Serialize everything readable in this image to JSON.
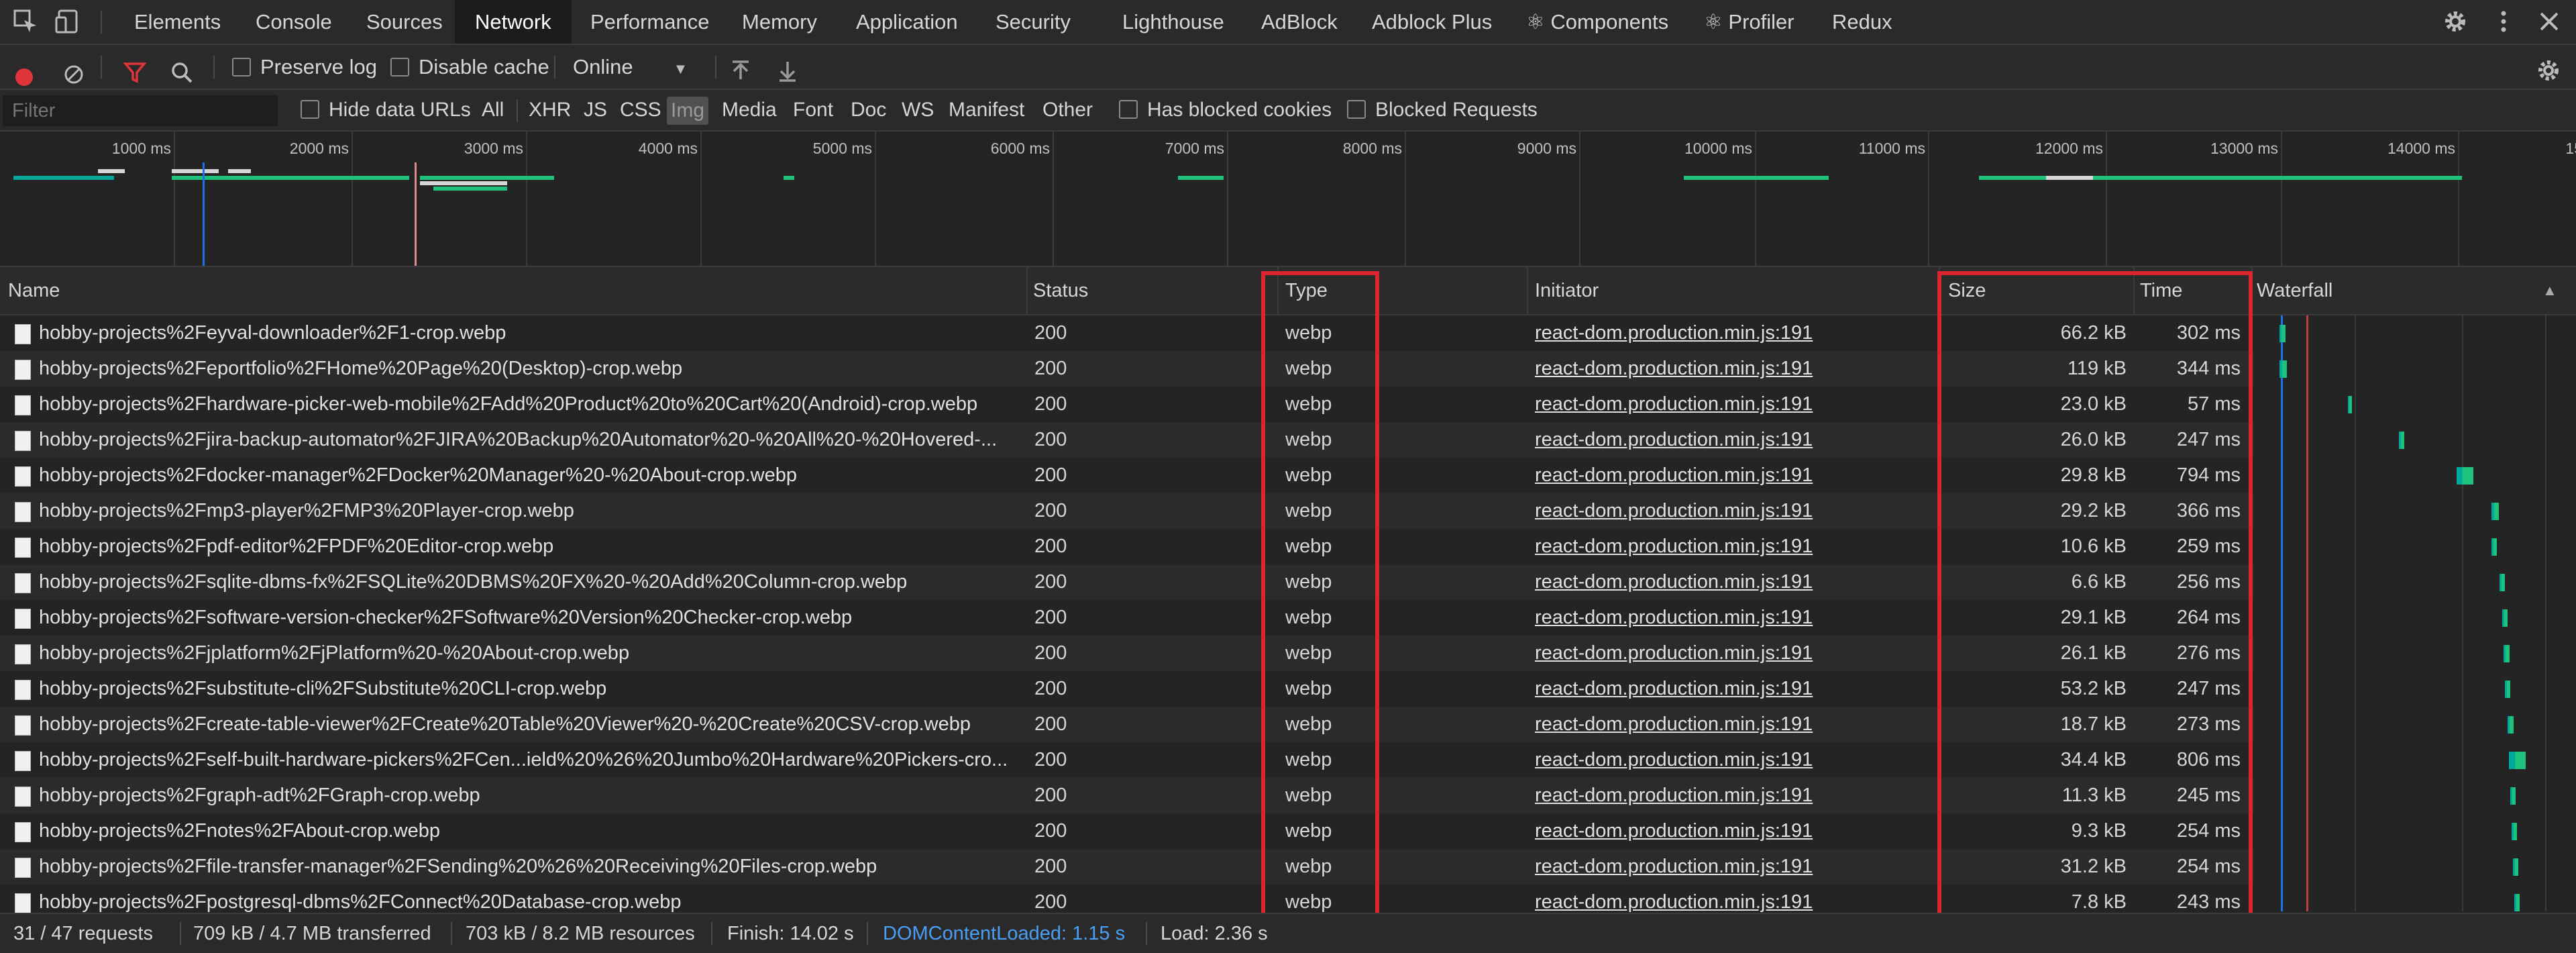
{
  "tabs": [
    "Elements",
    "Console",
    "Sources",
    "Network",
    "Performance",
    "Memory",
    "Application",
    "Security",
    "Lighthouse",
    "AdBlock",
    "Adblock Plus",
    "Components",
    "Profiler",
    "Redux"
  ],
  "active_tab": "Network",
  "toolbar": {
    "preserve_log": "Preserve log",
    "disable_cache": "Disable cache",
    "throttle": "Online"
  },
  "filterbar": {
    "placeholder": "Filter",
    "hide_data_urls": "Hide data URLs",
    "types": [
      "All",
      "XHR",
      "JS",
      "CSS",
      "Img",
      "Media",
      "Font",
      "Doc",
      "WS",
      "Manifest",
      "Other"
    ],
    "selected_type": "Img",
    "has_blocked_cookies": "Has blocked cookies",
    "blocked_requests": "Blocked Requests"
  },
  "overview": {
    "ticks": [
      "1000 ms",
      "2000 ms",
      "3000 ms",
      "4000 ms",
      "5000 ms",
      "6000 ms",
      "7000 ms",
      "8000 ms",
      "9000 ms",
      "10000 ms",
      "11000 ms",
      "12000 ms",
      "13000 ms",
      "14000 ms",
      "15"
    ]
  },
  "columns": {
    "name": "Name",
    "status": "Status",
    "type": "Type",
    "initiator": "Initiator",
    "size": "Size",
    "time": "Time",
    "waterfall": "Waterfall"
  },
  "rows": [
    {
      "name": "hobby-projects%2Feyval-downloader%2F1-crop.webp",
      "status": "200",
      "type": "webp",
      "initiator": "react-dom.production.min.js:191",
      "size": "66.2 kB",
      "time": "302 ms"
    },
    {
      "name": "hobby-projects%2Feportfolio%2FHome%20Page%20(Desktop)-crop.webp",
      "status": "200",
      "type": "webp",
      "initiator": "react-dom.production.min.js:191",
      "size": "119 kB",
      "time": "344 ms"
    },
    {
      "name": "hobby-projects%2Fhardware-picker-web-mobile%2FAdd%20Product%20to%20Cart%20(Android)-crop.webp",
      "status": "200",
      "type": "webp",
      "initiator": "react-dom.production.min.js:191",
      "size": "23.0 kB",
      "time": "57 ms"
    },
    {
      "name": "hobby-projects%2Fjira-backup-automator%2FJIRA%20Backup%20Automator%20-%20All%20-%20Hovered-...",
      "status": "200",
      "type": "webp",
      "initiator": "react-dom.production.min.js:191",
      "size": "26.0 kB",
      "time": "247 ms"
    },
    {
      "name": "hobby-projects%2Fdocker-manager%2FDocker%20Manager%20-%20About-crop.webp",
      "status": "200",
      "type": "webp",
      "initiator": "react-dom.production.min.js:191",
      "size": "29.8 kB",
      "time": "794 ms"
    },
    {
      "name": "hobby-projects%2Fmp3-player%2FMP3%20Player-crop.webp",
      "status": "200",
      "type": "webp",
      "initiator": "react-dom.production.min.js:191",
      "size": "29.2 kB",
      "time": "366 ms"
    },
    {
      "name": "hobby-projects%2Fpdf-editor%2FPDF%20Editor-crop.webp",
      "status": "200",
      "type": "webp",
      "initiator": "react-dom.production.min.js:191",
      "size": "10.6 kB",
      "time": "259 ms"
    },
    {
      "name": "hobby-projects%2Fsqlite-dbms-fx%2FSQLite%20DBMS%20FX%20-%20Add%20Column-crop.webp",
      "status": "200",
      "type": "webp",
      "initiator": "react-dom.production.min.js:191",
      "size": "6.6 kB",
      "time": "256 ms"
    },
    {
      "name": "hobby-projects%2Fsoftware-version-checker%2FSoftware%20Version%20Checker-crop.webp",
      "status": "200",
      "type": "webp",
      "initiator": "react-dom.production.min.js:191",
      "size": "29.1 kB",
      "time": "264 ms"
    },
    {
      "name": "hobby-projects%2Fjplatform%2FjPlatform%20-%20About-crop.webp",
      "status": "200",
      "type": "webp",
      "initiator": "react-dom.production.min.js:191",
      "size": "26.1 kB",
      "time": "276 ms"
    },
    {
      "name": "hobby-projects%2Fsubstitute-cli%2FSubstitute%20CLI-crop.webp",
      "status": "200",
      "type": "webp",
      "initiator": "react-dom.production.min.js:191",
      "size": "53.2 kB",
      "time": "247 ms"
    },
    {
      "name": "hobby-projects%2Fcreate-table-viewer%2FCreate%20Table%20Viewer%20-%20Create%20CSV-crop.webp",
      "status": "200",
      "type": "webp",
      "initiator": "react-dom.production.min.js:191",
      "size": "18.7 kB",
      "time": "273 ms"
    },
    {
      "name": "hobby-projects%2Fself-built-hardware-pickers%2FCen...ield%20%26%20Jumbo%20Hardware%20Pickers-cro...",
      "status": "200",
      "type": "webp",
      "initiator": "react-dom.production.min.js:191",
      "size": "34.4 kB",
      "time": "806 ms"
    },
    {
      "name": "hobby-projects%2Fgraph-adt%2FGraph-crop.webp",
      "status": "200",
      "type": "webp",
      "initiator": "react-dom.production.min.js:191",
      "size": "11.3 kB",
      "time": "245 ms"
    },
    {
      "name": "hobby-projects%2Fnotes%2FAbout-crop.webp",
      "status": "200",
      "type": "webp",
      "initiator": "react-dom.production.min.js:191",
      "size": "9.3 kB",
      "time": "254 ms"
    },
    {
      "name": "hobby-projects%2Ffile-transfer-manager%2FSending%20%26%20Receiving%20Files-crop.webp",
      "status": "200",
      "type": "webp",
      "initiator": "react-dom.production.min.js:191",
      "size": "31.2 kB",
      "time": "254 ms"
    },
    {
      "name": "hobby-projects%2Fpostgresql-dbms%2FConnect%20Database-crop.webp",
      "status": "200",
      "type": "webp",
      "initiator": "react-dom.production.min.js:191",
      "size": "7.8 kB",
      "time": "243 ms"
    }
  ],
  "status_bar": {
    "requests": "31 / 47 requests",
    "transferred": "709 kB / 4.7 MB transferred",
    "resources": "703 kB / 8.2 MB resources",
    "finish": "Finish: 14.02 s",
    "dom_content_loaded": "DOMContentLoaded: 1.15 s",
    "load": "Load: 2.36 s"
  },
  "colors": {
    "accent_blue": "#1a73e8",
    "record_red": "#e0363b",
    "highlight_red": "#d9262c",
    "waterfall_green": "#1ec27a",
    "waterfall_teal": "#00a79d"
  }
}
